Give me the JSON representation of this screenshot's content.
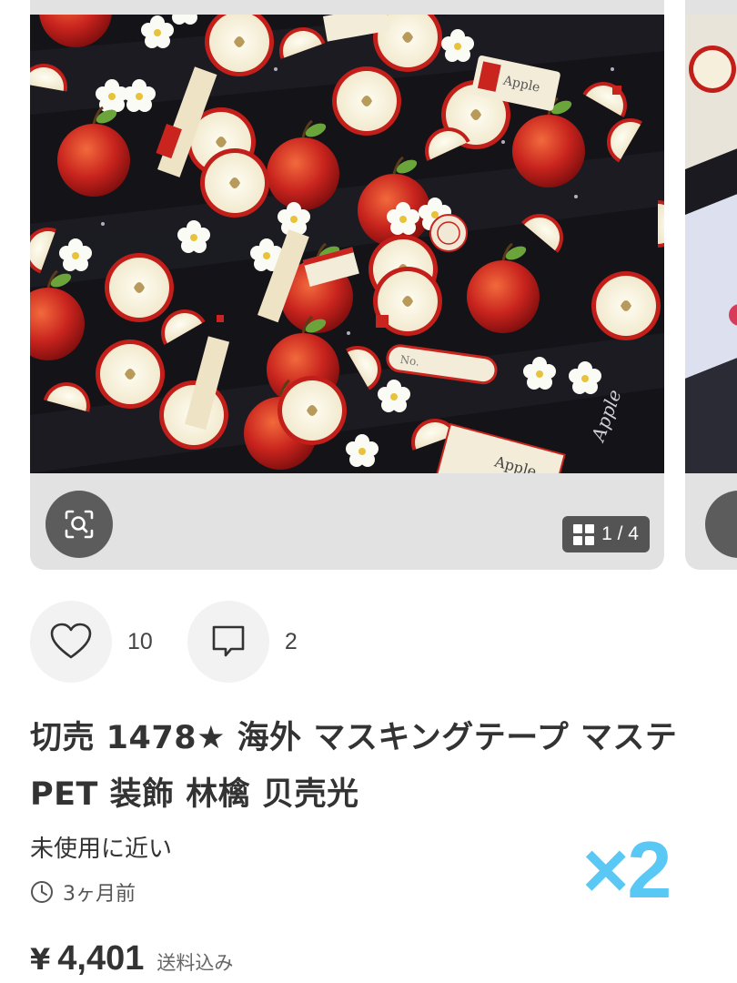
{
  "carousel": {
    "counter": "1 / 4",
    "photo_labels": {
      "tag1": "Apple",
      "tag2": "Apple",
      "tag3": "Apple",
      "label": "No."
    }
  },
  "actions": {
    "likes": "10",
    "comments": "2"
  },
  "item": {
    "title": "切売 1478★ 海外 マスキングテープ マステ PET 装飾 林檎 贝壳光",
    "condition": "未使用に近い",
    "posted": "3ヶ月前",
    "currency": "¥",
    "price": "4,401",
    "shipping": "送料込み"
  },
  "overlay": {
    "badge": "×2"
  },
  "colors": {
    "badge": "#5ac8f5",
    "apple_red": "#c9241e",
    "photo_bg": "#141318"
  }
}
